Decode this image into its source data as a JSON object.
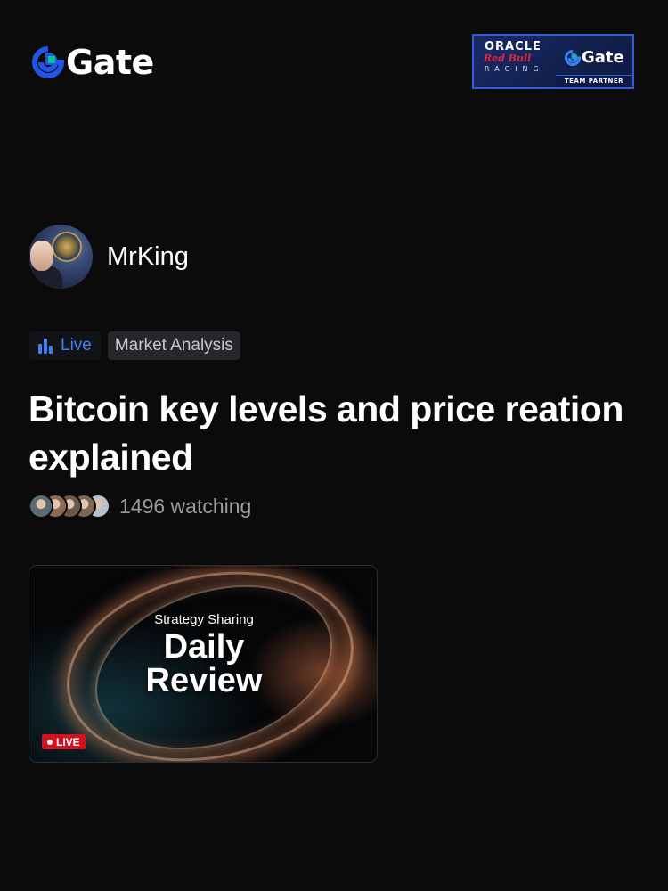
{
  "brand": {
    "name": "Gate",
    "accent": "#2354e6",
    "accent_secondary": "#00c98b"
  },
  "partner_banner": {
    "line1": "ORACLE",
    "line2": "Red Bull",
    "line3": "RACING",
    "partner_name": "Gate",
    "badge": "TEAM PARTNER"
  },
  "author": {
    "name": "MrKing"
  },
  "tags": {
    "live_label": "Live",
    "category": "Market Analysis",
    "live_color": "#3b82f6"
  },
  "stream": {
    "title": "Bitcoin key levels and price reation explained",
    "watching_count": "1496",
    "watching_label": "1496 watching"
  },
  "viewers": {
    "avatar_colors": [
      "#5b6b73",
      "#8a6a55",
      "#6a5a4e",
      "#7e6650",
      "#b8c2cc"
    ]
  },
  "thumbnail": {
    "subtitle": "Strategy Sharing",
    "heading_line1": "Daily",
    "heading_line2": "Review",
    "badge": "LIVE",
    "badge_color": "#d1121f"
  }
}
